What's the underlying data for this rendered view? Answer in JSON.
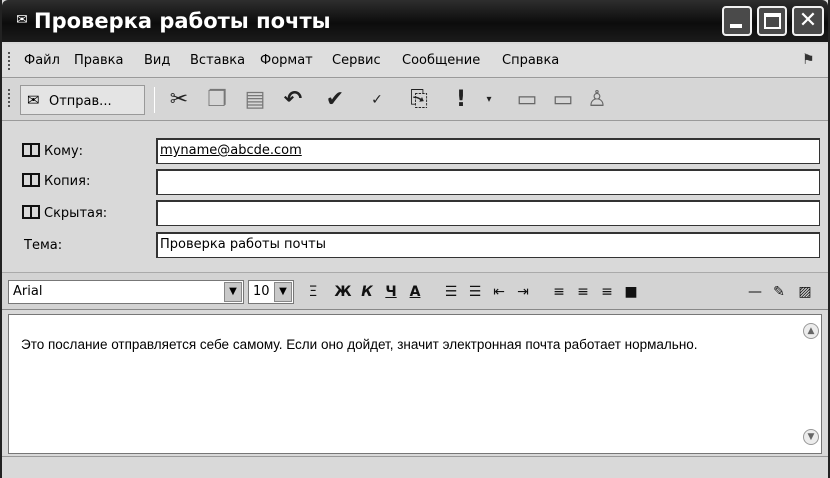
{
  "window": {
    "title": "Проверка работы почты",
    "title_icon": "envelope-icon"
  },
  "menu": {
    "file": "Файл",
    "edit": "Правка",
    "view": "Вид",
    "insert": "Вставка",
    "format": "Формат",
    "tools": "Сервис",
    "message": "Сообщение",
    "help": "Справка"
  },
  "toolbar": {
    "send_label": "Отправ...",
    "icons": [
      "cut-icon",
      "copy-icon",
      "paste-icon",
      "undo-icon",
      "check-names-icon",
      "spelling-icon",
      "attach-icon",
      "priority-icon",
      "sign-icon",
      "encrypt-icon",
      "offline-icon"
    ]
  },
  "address": {
    "to_label": "Кому:",
    "to_value": "myname@abcde.com",
    "cc_label": "Копия:",
    "cc_value": "",
    "bcc_label": "Скрытая:",
    "bcc_value": "",
    "subject_label": "Тема:",
    "subject_value": "Проверка работы почты"
  },
  "format": {
    "font": "Arial",
    "size": "10",
    "bold": "Ж",
    "italic": "К",
    "underline": "Ч",
    "font_color": "A"
  },
  "body": {
    "text": "Это послание отправляется себе самому. Если оно дойдет, значит электронная почта работает нормально."
  }
}
